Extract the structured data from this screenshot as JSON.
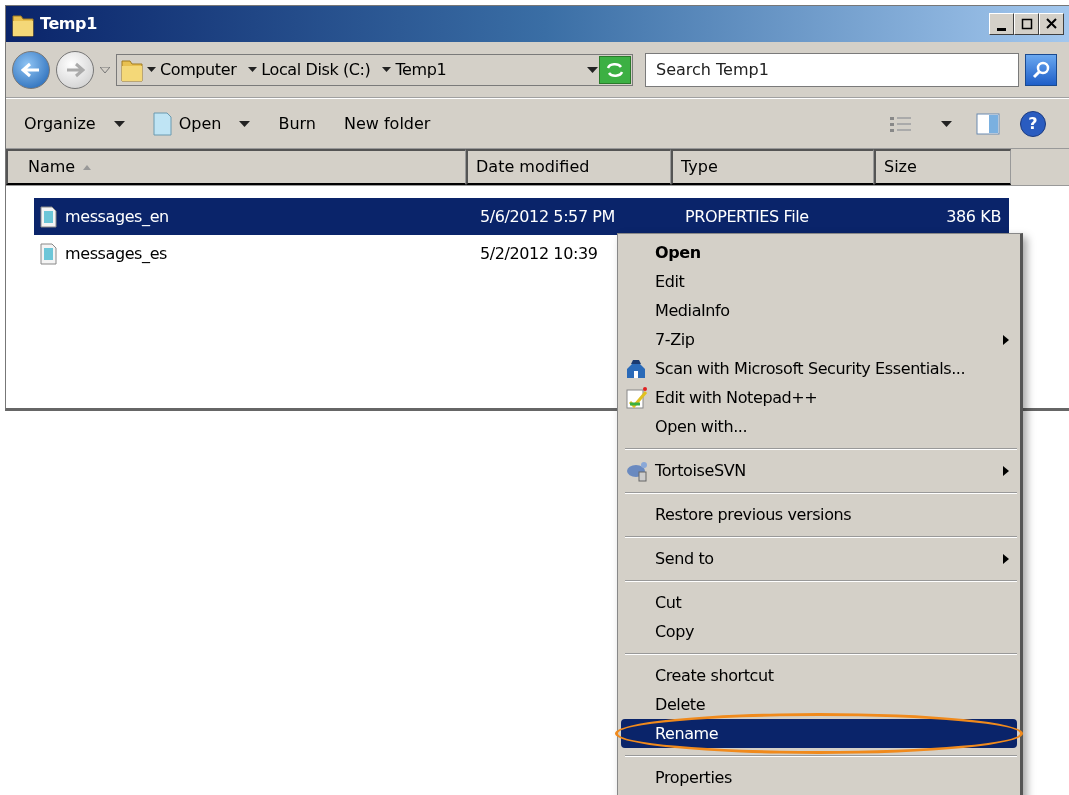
{
  "window": {
    "title": "Temp1"
  },
  "address_bar": {
    "segments": [
      "Computer",
      "Local Disk (C:)",
      "Temp1"
    ]
  },
  "search": {
    "placeholder": "Search Temp1"
  },
  "toolbar": {
    "buttons": [
      {
        "label": "Organize",
        "dropdown": true
      },
      {
        "label": "Open",
        "dropdown": true
      },
      {
        "label": "Burn",
        "dropdown": false
      },
      {
        "label": "New folder",
        "dropdown": false
      }
    ],
    "help_label": "?"
  },
  "table": {
    "columns": [
      {
        "label": "Name",
        "sorted": true
      },
      {
        "label": "Date modified",
        "sorted": false
      },
      {
        "label": "Type",
        "sorted": false
      },
      {
        "label": "Size",
        "sorted": false
      }
    ],
    "rows": [
      {
        "name": "messages_en",
        "date": "5/6/2012 5:57 PM",
        "type": "PROPERTIES File",
        "size": "386 KB",
        "selected": true
      },
      {
        "name": "messages_es",
        "date": "5/2/2012 10:39",
        "selected": false
      }
    ]
  },
  "context_menu": {
    "groups": [
      [
        {
          "label": "Open",
          "default": true,
          "submenu": false,
          "selected": false,
          "circled": false
        },
        {
          "label": "Edit",
          "default": false,
          "submenu": false,
          "selected": false,
          "circled": false
        },
        {
          "label": "MediaInfo",
          "default": false,
          "submenu": false,
          "selected": false,
          "circled": false
        },
        {
          "label": "7-Zip",
          "default": false,
          "submenu": true,
          "selected": false,
          "circled": false
        },
        {
          "label": "Scan with Microsoft Security Essentials...",
          "default": false,
          "submenu": false,
          "selected": false,
          "circled": false
        },
        {
          "label": "Edit with Notepad++",
          "default": false,
          "submenu": false,
          "selected": false,
          "circled": false
        },
        {
          "label": "Open with...",
          "default": false,
          "submenu": false,
          "selected": false,
          "circled": false
        }
      ],
      [
        {
          "label": "TortoiseSVN",
          "default": false,
          "submenu": true,
          "selected": false,
          "circled": false
        }
      ],
      [
        {
          "label": "Restore previous versions",
          "default": false,
          "submenu": false,
          "selected": false,
          "circled": false
        }
      ],
      [
        {
          "label": "Send to",
          "default": false,
          "submenu": true,
          "selected": false,
          "circled": false
        }
      ],
      [
        {
          "label": "Cut",
          "default": false,
          "submenu": false,
          "selected": false,
          "circled": false
        },
        {
          "label": "Copy",
          "default": false,
          "submenu": false,
          "selected": false,
          "circled": false
        }
      ],
      [
        {
          "label": "Create shortcut",
          "default": false,
          "submenu": false,
          "selected": false,
          "circled": false
        },
        {
          "label": "Delete",
          "default": false,
          "submenu": false,
          "selected": false,
          "circled": false
        },
        {
          "label": "Rename",
          "default": false,
          "submenu": false,
          "selected": true,
          "circled": true
        }
      ],
      [
        {
          "label": "Properties",
          "default": false,
          "submenu": false,
          "selected": false,
          "circled": false
        }
      ]
    ]
  }
}
